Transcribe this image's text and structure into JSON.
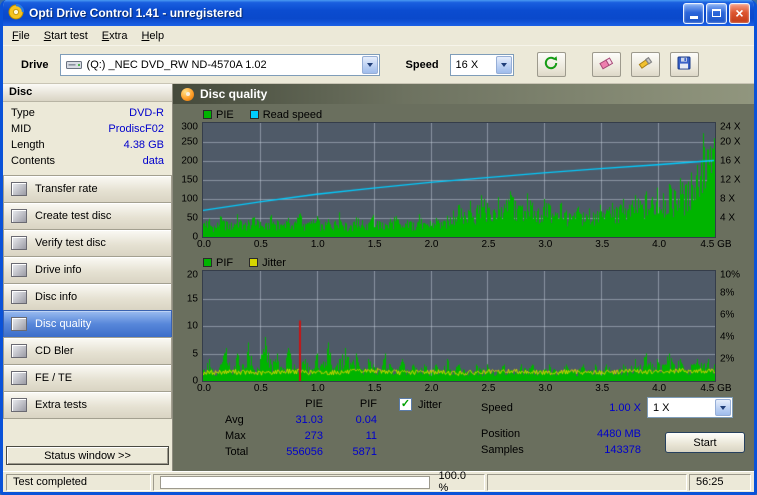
{
  "window": {
    "title": "Opti Drive Control 1.41 - unregistered"
  },
  "menu": {
    "items": [
      {
        "label": "File"
      },
      {
        "label": "Start test"
      },
      {
        "label": "Extra"
      },
      {
        "label": "Help"
      }
    ]
  },
  "toolbar": {
    "drive_label": "Drive",
    "drive_value": "(Q:) _NEC DVD_RW ND-4570A 1.02",
    "speed_label": "Speed",
    "speed_value": "16 X"
  },
  "sidebar": {
    "section_title": "Disc",
    "info": [
      {
        "label": "Type",
        "value": "DVD-R"
      },
      {
        "label": "MID",
        "value": "ProdiscF02"
      },
      {
        "label": "Length",
        "value": "4.38 GB"
      },
      {
        "label": "Contents",
        "value": "data"
      }
    ],
    "buttons": [
      {
        "label": "Transfer rate",
        "selected": false
      },
      {
        "label": "Create test disc",
        "selected": false
      },
      {
        "label": "Verify test disc",
        "selected": false
      },
      {
        "label": "Drive info",
        "selected": false
      },
      {
        "label": "Disc info",
        "selected": false
      },
      {
        "label": "Disc quality",
        "selected": true
      },
      {
        "label": "CD Bler",
        "selected": false
      },
      {
        "label": "FE / TE",
        "selected": false
      },
      {
        "label": "Extra tests",
        "selected": false
      }
    ],
    "status_window_label": "Status window >>"
  },
  "main": {
    "header": "Disc quality",
    "stats": {
      "col_headers": [
        "PIE",
        "PIF"
      ],
      "rows": [
        {
          "label": "Avg",
          "pie": "31.03",
          "pif": "0.04"
        },
        {
          "label": "Max",
          "pie": "273",
          "pif": "11"
        },
        {
          "label": "Total",
          "pie": "556056",
          "pif": "5871"
        }
      ],
      "jitter_checkbox_label": "Jitter",
      "jitter_checked": true,
      "right_rows": [
        {
          "label": "Speed",
          "value": "1.00 X"
        },
        {
          "label": "Position",
          "value": "4480 MB"
        },
        {
          "label": "Samples",
          "value": "143378"
        }
      ],
      "speed_select_value": "1 X",
      "start_button_label": "Start"
    }
  },
  "statusbar": {
    "left": "Test completed",
    "progress": "100.0 %",
    "progress_percent": 100,
    "time": "56:25"
  },
  "chart_data": [
    {
      "type": "area",
      "title": "PIE / Read speed",
      "legend": [
        {
          "label": "PIE",
          "color": "#00b400"
        },
        {
          "label": "Read speed",
          "color": "#00ccff"
        }
      ],
      "x_range": [
        0,
        4.5
      ],
      "x_step": 0.05,
      "x_ticks": [
        "0.0",
        "0.5",
        "1.0",
        "1.5",
        "2.0",
        "2.5",
        "3.0",
        "3.5",
        "4.0",
        "4.5 GB"
      ],
      "y_left_range": [
        0,
        300
      ],
      "y_left_ticks": [
        0,
        50,
        100,
        150,
        200,
        250,
        300
      ],
      "y_right_range": [
        0,
        24
      ],
      "y_right_ticks": [
        {
          "v": 4,
          "label": "4 X"
        },
        {
          "v": 8,
          "label": "8 X"
        },
        {
          "v": 12,
          "label": "12 X"
        },
        {
          "v": 16,
          "label": "16 X"
        },
        {
          "v": 20,
          "label": "20 X"
        },
        {
          "v": 24,
          "label": "24 X"
        }
      ],
      "grid": true,
      "pie_values": [
        35,
        48,
        30,
        55,
        42,
        38,
        60,
        33,
        45,
        52,
        40,
        35,
        58,
        44,
        30,
        50,
        38,
        62,
        35,
        42,
        55,
        33,
        47,
        40,
        65,
        38,
        30,
        52,
        44,
        36,
        58,
        42,
        35,
        48,
        55,
        30,
        44,
        38,
        60,
        35,
        42,
        50,
        38,
        56,
        70,
        85,
        65,
        95,
        75,
        110,
        90,
        70,
        105,
        85,
        120,
        95,
        80,
        115,
        90,
        75,
        100,
        85,
        65,
        90,
        70,
        55,
        80,
        65,
        75,
        60,
        85,
        70,
        90,
        75,
        100,
        85,
        110,
        95,
        120,
        105,
        130,
        115,
        140,
        125,
        155,
        140,
        170,
        190,
        273,
        230,
        260
      ],
      "read_speed_points": [
        [
          0,
          5.6
        ],
        [
          0.5,
          7.4
        ],
        [
          1,
          9.0
        ],
        [
          1.5,
          10.3
        ],
        [
          2,
          11.5
        ],
        [
          2.5,
          12.5
        ],
        [
          3,
          13.5
        ],
        [
          3.5,
          14.4
        ],
        [
          4,
          15.2
        ],
        [
          4.38,
          15.9
        ],
        [
          4.5,
          16.1
        ]
      ]
    },
    {
      "type": "bar",
      "title": "PIF / Jitter",
      "legend": [
        {
          "label": "PIF",
          "color": "#00b400"
        },
        {
          "label": "Jitter",
          "color": "#d6d600"
        }
      ],
      "x_range": [
        0,
        4.5
      ],
      "x_step": 0.05,
      "x_ticks": [
        "0.0",
        "0.5",
        "1.0",
        "1.5",
        "2.0",
        "2.5",
        "3.0",
        "3.5",
        "4.0",
        "4.5 GB"
      ],
      "y_left_range": [
        0,
        20
      ],
      "y_left_ticks": [
        0,
        5,
        10,
        15,
        20
      ],
      "y_right_range": [
        0,
        10
      ],
      "y_right_ticks": [
        {
          "v": 2,
          "label": "2%"
        },
        {
          "v": 4,
          "label": "4%"
        },
        {
          "v": 6,
          "label": "6%"
        },
        {
          "v": 8,
          "label": "8%"
        },
        {
          "v": 10,
          "label": "10%"
        }
      ],
      "grid": true,
      "pif_values": [
        2,
        4,
        1,
        3,
        6,
        2,
        5,
        3,
        7,
        2,
        4,
        8,
        3,
        5,
        2,
        6,
        3,
        11,
        4,
        2,
        5,
        3,
        7,
        2,
        4,
        6,
        3,
        5,
        2,
        4,
        3,
        2,
        5,
        3,
        2,
        4,
        2,
        3,
        2,
        3,
        2,
        3,
        2,
        4,
        2,
        3,
        2,
        2,
        3,
        2,
        3,
        2,
        2,
        3,
        2,
        2,
        3,
        2,
        3,
        2,
        2,
        3,
        2,
        2,
        3,
        2,
        2,
        3,
        2,
        3,
        2,
        3,
        2,
        2,
        3,
        2,
        4,
        3,
        5,
        3,
        4,
        3,
        5,
        3,
        4,
        2,
        3,
        4,
        3,
        4,
        3
      ],
      "pif_red_index": 17,
      "pif_red": {
        "x": 0.85,
        "value": 11
      },
      "jitter_points": [
        [
          0,
          1.5
        ],
        [
          0.25,
          1.7
        ],
        [
          0.5,
          1.4
        ],
        [
          0.75,
          1.8
        ],
        [
          1,
          1.5
        ],
        [
          1.25,
          1.6
        ],
        [
          1.5,
          1.9
        ],
        [
          1.75,
          1.5
        ],
        [
          2,
          1.7
        ],
        [
          2.25,
          1.4
        ],
        [
          2.5,
          1.6
        ],
        [
          2.75,
          1.8
        ],
        [
          3,
          1.5
        ],
        [
          3.25,
          1.7
        ],
        [
          3.5,
          1.5
        ],
        [
          3.75,
          1.8
        ],
        [
          4,
          1.6
        ],
        [
          4.25,
          1.9
        ],
        [
          4.5,
          1.7
        ]
      ]
    }
  ]
}
